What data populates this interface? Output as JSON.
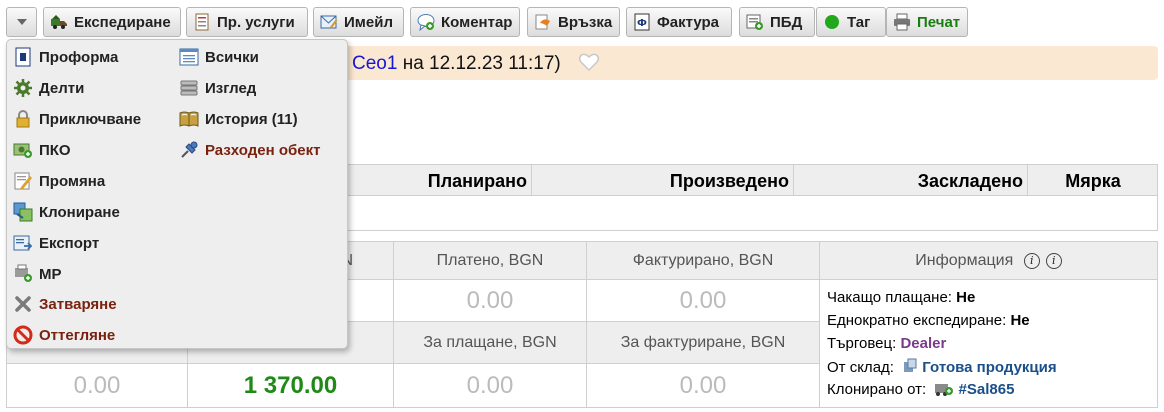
{
  "toolbar": {
    "buttons": [
      {
        "label": "Експедиране",
        "icon": "truck-icon"
      },
      {
        "label": "Пр. услуги",
        "icon": "document-list-icon"
      },
      {
        "label": "Имейл",
        "icon": "email-edit-icon"
      },
      {
        "label": "Коментар",
        "icon": "comment-add-icon"
      },
      {
        "label": "Връзка",
        "icon": "link-icon"
      },
      {
        "label": "Фактура",
        "icon": "invoice-icon"
      },
      {
        "label": "ПБД",
        "icon": "bank-doc-icon"
      },
      {
        "label": "Таг",
        "icon": "green-dot-icon"
      },
      {
        "label": "Печат",
        "icon": "printer-icon"
      }
    ]
  },
  "header": {
    "author_link": "Ceo1",
    "date_text": "на 12.12.23 11:17)"
  },
  "menu": {
    "left": [
      {
        "label": "Проформа",
        "icon": "proforma-icon",
        "color": "#222222"
      },
      {
        "label": "Делти",
        "icon": "gear-icon",
        "color": "#222222"
      },
      {
        "label": "Приключване",
        "icon": "lock-icon",
        "color": "#222222"
      },
      {
        "label": "ПКО",
        "icon": "cash-order-icon",
        "color": "#222222"
      },
      {
        "label": "Промяна",
        "icon": "edit-icon",
        "color": "#222222"
      },
      {
        "label": "Клониране",
        "icon": "clone-icon",
        "color": "#222222"
      },
      {
        "label": "Експорт",
        "icon": "export-icon",
        "color": "#222222"
      },
      {
        "label": "МР",
        "icon": "mp-icon",
        "color": "#222222"
      },
      {
        "label": "Затваряне",
        "icon": "close-icon",
        "color": "#7a2210"
      },
      {
        "label": "Оттегляне",
        "icon": "cancel-icon",
        "color": "#7a2210"
      }
    ],
    "right": [
      {
        "label": "Всички",
        "icon": "list-icon",
        "color": "#222222"
      },
      {
        "label": "Изглед",
        "icon": "stack-icon",
        "color": "#222222"
      },
      {
        "label": "История (11)",
        "icon": "book-icon",
        "color": "#222222"
      },
      {
        "label": "Разходен обект",
        "icon": "pin-icon",
        "color": "#7a2210"
      }
    ]
  },
  "quantities_table": {
    "columns": [
      "Планирано",
      "Произведено",
      "Заскладено",
      "Мярка"
    ]
  },
  "amounts": {
    "headers": {
      "paid": "Платено, BGN",
      "invoiced": "Фактурирано, BGN",
      "to_pay": "За плащане, BGN",
      "to_invoice": "За фактуриране, BGN",
      "partial_right_fragment": "N"
    },
    "values": {
      "paid": "0.00",
      "invoiced": "0.00",
      "col1_bottom": "0.00",
      "col2_bottom": "1 370.00",
      "to_pay": "0.00",
      "to_invoice": "0.00"
    }
  },
  "info": {
    "title": "Информация",
    "rows": {
      "awaiting_payment_label": "Чакащо плащане:",
      "awaiting_payment_value": "Не",
      "single_shipment_label": "Еднократно експедиране:",
      "single_shipment_value": "Не",
      "dealer_label": "Търговец:",
      "dealer_value": "Dealer",
      "warehouse_label": "От склад:",
      "warehouse_value": "Готова продукция",
      "cloned_label": "Клонирано от:",
      "cloned_value": "#Sal865"
    }
  }
}
